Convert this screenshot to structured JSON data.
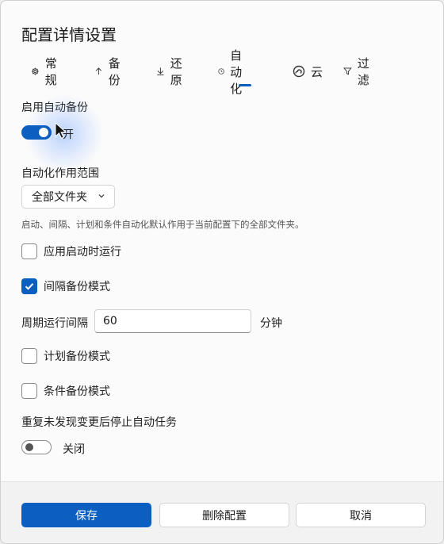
{
  "dialog": {
    "title": "配置详情设置"
  },
  "tabs": [
    {
      "label": "常规",
      "icon": "gear-icon"
    },
    {
      "label": "备份",
      "icon": "arrow-up-icon"
    },
    {
      "label": "还原",
      "icon": "arrow-down-icon"
    },
    {
      "label": "自动化",
      "icon": "clock-icon",
      "active": true
    },
    {
      "label": "云",
      "icon": "cloud-icon"
    },
    {
      "label": "过滤",
      "icon": "filter-icon"
    }
  ],
  "auto_backup": {
    "label": "启用自动备份",
    "state_label": "开",
    "enabled": true
  },
  "scope": {
    "label": "自动化作用范围",
    "selected": "全部文件夹",
    "hint": "启动、间隔、计划和条件自动化默认作用于当前配置下的全部文件夹。"
  },
  "options": {
    "run_on_start": {
      "label": "应用启动时运行",
      "checked": false
    },
    "interval_mode": {
      "label": "间隔备份模式",
      "checked": true
    },
    "interval": {
      "label": "周期运行间隔",
      "value": "60",
      "unit": "分钟"
    },
    "schedule_mode": {
      "label": "计划备份模式",
      "checked": false
    },
    "condition_mode": {
      "label": "条件备份模式",
      "checked": false
    }
  },
  "stop_on_no_change": {
    "label": "重复未发现变更后停止自动任务",
    "state_label": "关闭",
    "enabled": false
  },
  "footer": {
    "save": "保存",
    "delete": "删除配置",
    "cancel": "取消"
  },
  "colors": {
    "accent": "#0a5fc1"
  }
}
